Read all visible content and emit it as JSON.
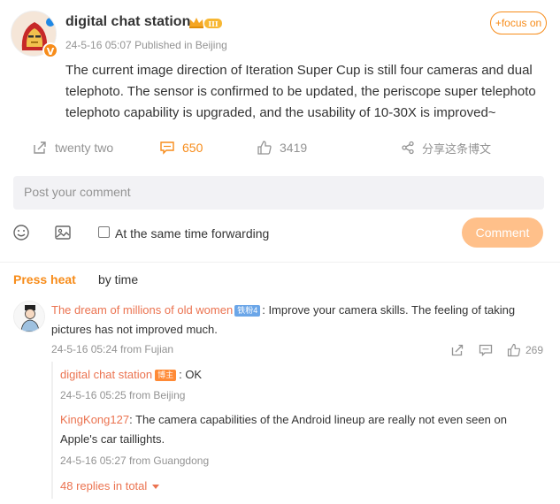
{
  "post": {
    "author": "digital chat station",
    "verified_badge": "V",
    "timestamp": "24-5-16 05:07",
    "published_in": "Published in Beijing",
    "focus_label": "+focus on",
    "body": "The current image direction of Iteration Super Cup is still four cameras and dual telephoto. The sensor is confirmed to be updated, the periscope super telephoto telephoto capability is upgraded, and the usability of 10-30X is improved~"
  },
  "actions": {
    "forward_label": "twenty two",
    "comment_count": "650",
    "like_count": "3419",
    "share_label": "分享这条博文"
  },
  "composer": {
    "placeholder": "Post your comment",
    "forward_label": "At the same time forwarding",
    "submit_label": "Comment"
  },
  "sort": {
    "heat_label": "Press heat",
    "time_label": "by time"
  },
  "comments": [
    {
      "author": "The dream of millions of old women",
      "fan_badge": "铁粉4",
      "text": ": Improve your camera skills. The feeling of taking pictures has not improved much.",
      "meta": "24-5-16 05:24 from Fujian",
      "likes": "269",
      "replies": [
        {
          "author": "digital chat station",
          "owner_badge": "博主",
          "text": ": OK",
          "meta": "24-5-16 05:25 from Beijing"
        },
        {
          "author": "KingKong127",
          "text": ": The camera capabilities of the Android lineup are really not even seen on Apple's car taillights.",
          "meta": "24-5-16 05:27 from Guangdong"
        }
      ],
      "more_replies": "48 replies in total"
    }
  ],
  "colors": {
    "accent": "#f78c1a",
    "link": "#eb7350",
    "muted": "#939393"
  }
}
